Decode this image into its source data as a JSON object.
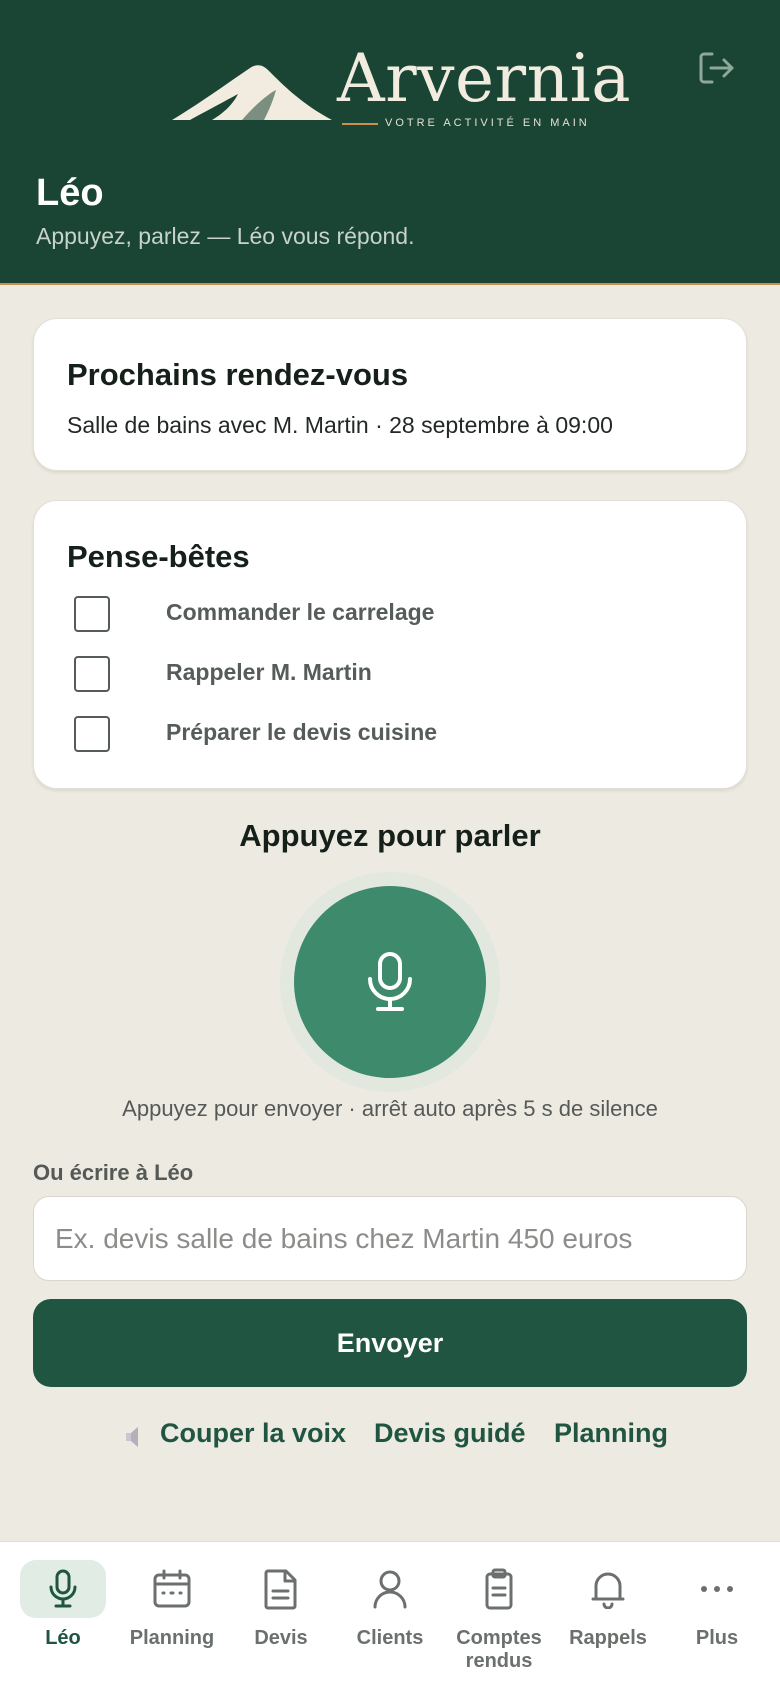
{
  "header": {
    "brand": "Arvernia",
    "tagline": "VOTRE ACTIVITÉ EN MAIN",
    "logout_icon": "logout-icon",
    "title": "Léo",
    "subtitle": "Appuyez, parlez — Léo vous répond."
  },
  "appointments": {
    "title": "Prochains rendez-vous",
    "next": "Salle de bains avec M. Martin · 28 septembre à 09:00"
  },
  "reminders": {
    "title": "Pense-bêtes",
    "items": [
      {
        "label": "Commander le carrelage",
        "checked": false
      },
      {
        "label": "Rappeler M. Martin",
        "checked": false
      },
      {
        "label": "Préparer le devis cuisine",
        "checked": false
      }
    ]
  },
  "voice": {
    "title": "Appuyez pour parler",
    "hint": "Appuyez pour envoyer · arrêt auto après 5 s de silence",
    "icon": "microphone-icon"
  },
  "compose": {
    "label": "Ou écrire à Léo",
    "value": "",
    "placeholder": "Ex. devis salle de bains chez Martin 450 euros",
    "send_label": "Envoyer"
  },
  "quick_links": {
    "mute_label": "Couper la voix",
    "guided_quote_label": "Devis guidé",
    "planning_label": "Planning"
  },
  "tabs": [
    {
      "label": "Léo",
      "icon": "microphone-icon",
      "active": true
    },
    {
      "label": "Planning",
      "icon": "calendar-icon",
      "active": false
    },
    {
      "label": "Devis",
      "icon": "document-icon",
      "active": false
    },
    {
      "label": "Clients",
      "icon": "user-icon",
      "active": false
    },
    {
      "label": "Comptes rendus",
      "icon": "clipboard-icon",
      "active": false
    },
    {
      "label": "Rappels",
      "icon": "bell-icon",
      "active": false
    },
    {
      "label": "Plus",
      "icon": "more-icon",
      "active": false
    }
  ],
  "colors": {
    "header_bg": "#1A4433",
    "accent": "#C9904C",
    "primary": "#1F5541",
    "mic": "#3E8A6D",
    "background": "#EDEAE2"
  }
}
